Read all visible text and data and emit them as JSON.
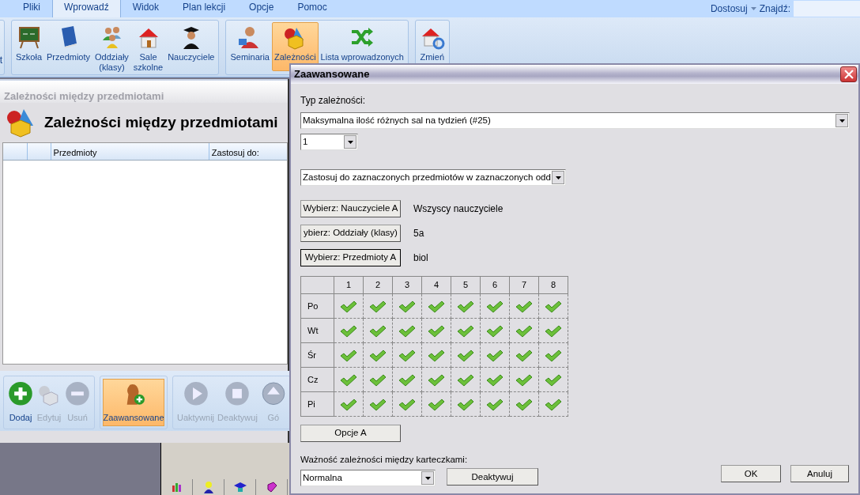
{
  "menu_tabs": [
    {
      "label": "Pliki",
      "selected": false
    },
    {
      "label": "Wprowadź",
      "selected": true
    },
    {
      "label": "Widok",
      "selected": false
    },
    {
      "label": "Plan lekcji",
      "selected": false
    },
    {
      "label": "Opcje",
      "selected": false
    },
    {
      "label": "Pomoc",
      "selected": false
    }
  ],
  "customize": "Dostosuj",
  "find_label": "Znajdź:",
  "ribbon": {
    "cut_label": "t",
    "groups": [
      [
        {
          "label": "Szkoła",
          "selected": false
        },
        {
          "label": "Przedmioty",
          "selected": false
        },
        {
          "label": "Oddziały (klasy)",
          "selected": false
        },
        {
          "label": "Sale szkolne",
          "selected": false
        },
        {
          "label": "Nauczyciele",
          "selected": false
        }
      ],
      [
        {
          "label": "Seminaria",
          "selected": false
        },
        {
          "label": "Zależności",
          "selected": true
        },
        {
          "label": "Lista wprowadzonych",
          "selected": false
        }
      ],
      [
        {
          "label": "Zmień",
          "selected": false
        }
      ]
    ]
  },
  "panel": {
    "title": "Zależności między przedmiotami",
    "heading": "Zależności między przedmiotami",
    "columns": [
      {
        "label": "Przedmioty"
      },
      {
        "label": "Zastosuj do:"
      }
    ]
  },
  "toolbar": [
    [
      {
        "label": "Dodaj",
        "disabled": false,
        "selected": false
      },
      {
        "label": "Edytuj",
        "disabled": true,
        "selected": false
      },
      {
        "label": "Usuń",
        "disabled": true,
        "selected": false
      }
    ],
    [
      {
        "label": "Zaawansowane",
        "disabled": false,
        "selected": true
      }
    ],
    [
      {
        "label": "Uaktywnij",
        "disabled": true,
        "selected": false
      },
      {
        "label": "Deaktywuj",
        "disabled": true,
        "selected": false
      },
      {
        "label": "Gó",
        "disabled": true,
        "selected": false
      }
    ]
  ],
  "dialog": {
    "title": "Zaawansowane",
    "type_label": "Typ zależności:",
    "type_select": "Maksymalna ilość różnych sal na tydzień (#25)",
    "count_select": "1",
    "apply_select": "Zastosuj do zaznaczonych przedmiotów w zaznaczonych odd",
    "choosers": [
      {
        "button": "Wybierz: Nauczyciele A",
        "value": "Wszyscy nauczyciele",
        "focused": false
      },
      {
        "button": "ybierz: Oddziały (klasy)",
        "value": "5a",
        "focused": false
      },
      {
        "button": "Wybierz: Przedmioty A",
        "value": "biol",
        "focused": true
      }
    ],
    "hours": [
      "1",
      "2",
      "3",
      "4",
      "5",
      "6",
      "7",
      "8"
    ],
    "days": [
      {
        "label": "Po",
        "checked": [
          true,
          true,
          true,
          true,
          true,
          true,
          true,
          true
        ]
      },
      {
        "label": "Wt",
        "checked": [
          true,
          true,
          true,
          true,
          true,
          true,
          true,
          true
        ]
      },
      {
        "label": "Śr",
        "checked": [
          true,
          true,
          true,
          true,
          true,
          true,
          true,
          true
        ]
      },
      {
        "label": "Cz",
        "checked": [
          true,
          true,
          true,
          true,
          true,
          true,
          true,
          true
        ]
      },
      {
        "label": "Pi",
        "checked": [
          true,
          true,
          true,
          true,
          true,
          true,
          true,
          true
        ]
      }
    ],
    "options_button": "Opcje A",
    "importance_label": "Ważność zależności między karteczkami:",
    "importance_select": "Normalna",
    "deactivate_button": "Deaktywuj",
    "ok_button": "OK",
    "cancel_button": "Anuluj"
  }
}
